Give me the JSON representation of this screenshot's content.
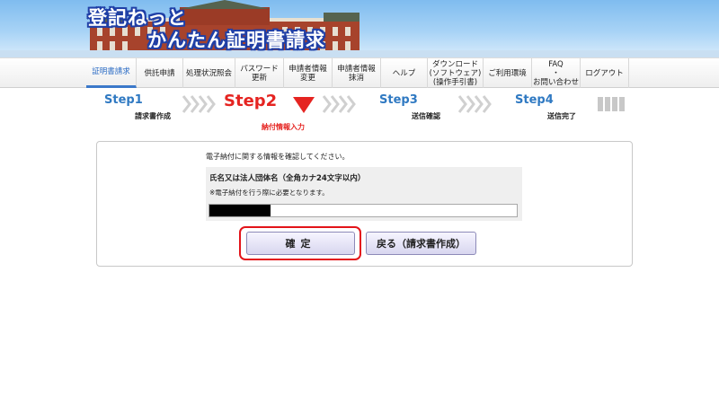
{
  "header": {
    "logo_line1": "登記ねっと",
    "logo_line2": "かんたん証明書請求"
  },
  "nav": {
    "items": [
      {
        "label": "証明書請求",
        "active": true
      },
      {
        "label": "供託申請",
        "active": false
      },
      {
        "label": "処理状況照会",
        "active": false
      },
      {
        "label": "パスワード\n更新",
        "active": false
      },
      {
        "label": "申請者情報\n変更",
        "active": false
      },
      {
        "label": "申請者情報\n抹消",
        "active": false
      },
      {
        "label": "ヘルプ",
        "active": false
      },
      {
        "label": "ダウンロード\n(ソフトウェア)\n(操作手引書)",
        "active": false
      },
      {
        "label": "ご利用環境",
        "active": false
      },
      {
        "label": "FAQ\n・\nお問い合わせ",
        "active": false
      },
      {
        "label": "ログアウト",
        "active": false
      }
    ]
  },
  "steps": [
    {
      "title": "Step1",
      "label": "請求書作成",
      "current": false
    },
    {
      "title": "Step2",
      "label": "納付情報入力",
      "current": true
    },
    {
      "title": "Step3",
      "label": "送信確認",
      "current": false
    },
    {
      "title": "Step4",
      "label": "送信完了",
      "current": false
    }
  ],
  "colors": {
    "accent_blue": "#2f79c2",
    "current_step_red": "#e52421",
    "highlight_red": "#e3141a"
  },
  "form": {
    "intro": "電子納付に関する情報を確認してください。",
    "name_label": "氏名又は法人団体名（全角カナ24文字以内）",
    "name_note": "※電子納付を行う際に必要となります。",
    "name_value": ""
  },
  "buttons": {
    "confirm": "確定",
    "back": "戻る（請求書作成）"
  }
}
